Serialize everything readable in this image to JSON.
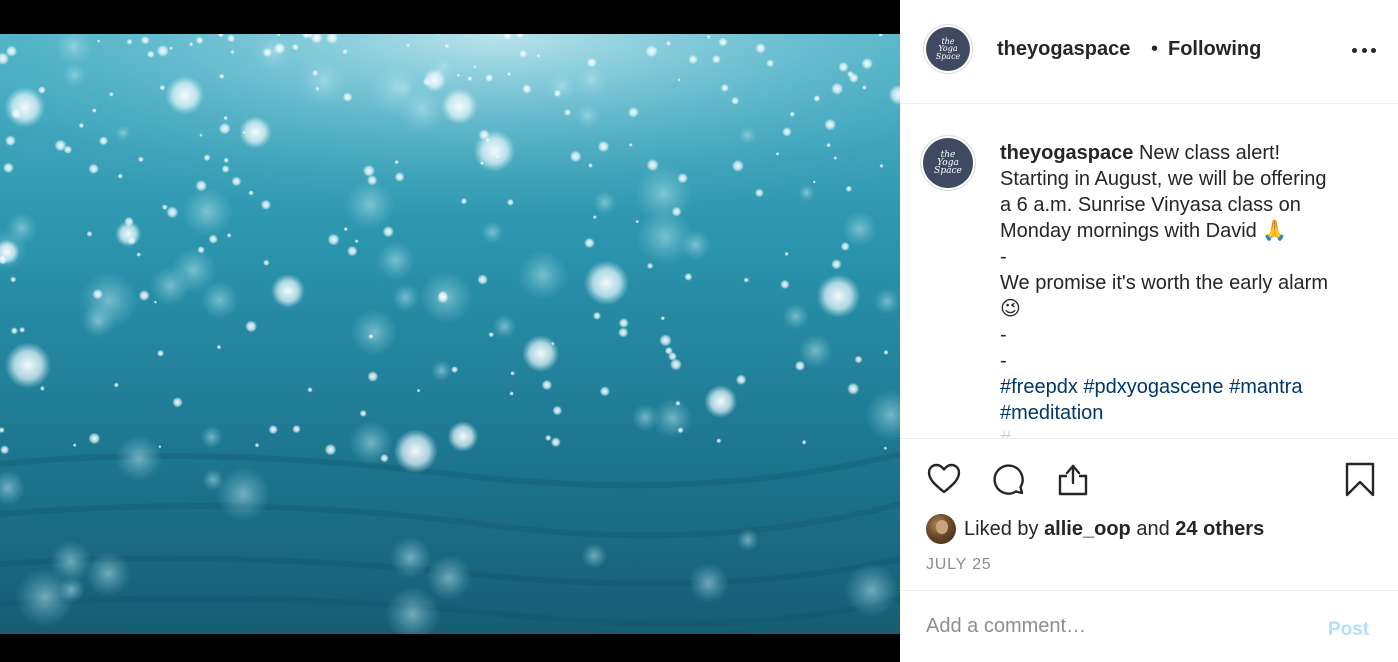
{
  "photo": {
    "alt_theme": "underwater bubbles",
    "colors": {
      "deep": "#17586e",
      "mid": "#2a8ea8",
      "light": "#4fb4c9",
      "highlight": "#bfe8f0"
    }
  },
  "header": {
    "avatar_text_line1": "the",
    "avatar_text_line2": "Yoga",
    "avatar_text_line3": "Space",
    "username": "theyogaspace",
    "separator": "•",
    "follow_status": "Following",
    "more_icon": "more-horizontal-icon"
  },
  "caption": {
    "username": "theyogaspace",
    "line1": "New class alert!",
    "line2": "Starting in August, we will be offering",
    "line3": "a 6 a.m. Sunrise Vinyasa class on",
    "line4": "Monday mornings with David 🙏",
    "dash1": "-",
    "line5": "We promise it's worth the early alarm",
    "emoji": "😉",
    "dash2": "-",
    "dash3": "-",
    "tags_row1": [
      "#freepdx",
      "#pdxyogascene",
      "#mantra"
    ],
    "tags_row2": [
      "#meditation"
    ],
    "tags_row3_partial": "#..."
  },
  "actions": {
    "like_icon": "heart-icon",
    "comment_icon": "comment-bubble-icon",
    "share_icon": "share-icon",
    "save_icon": "bookmark-icon"
  },
  "likes": {
    "prefix": "Liked by",
    "user": "allie_oop",
    "connector": "and",
    "others": "24 others"
  },
  "date": "JULY 25",
  "comment_box": {
    "placeholder": "Add a comment…",
    "post_label": "Post"
  }
}
